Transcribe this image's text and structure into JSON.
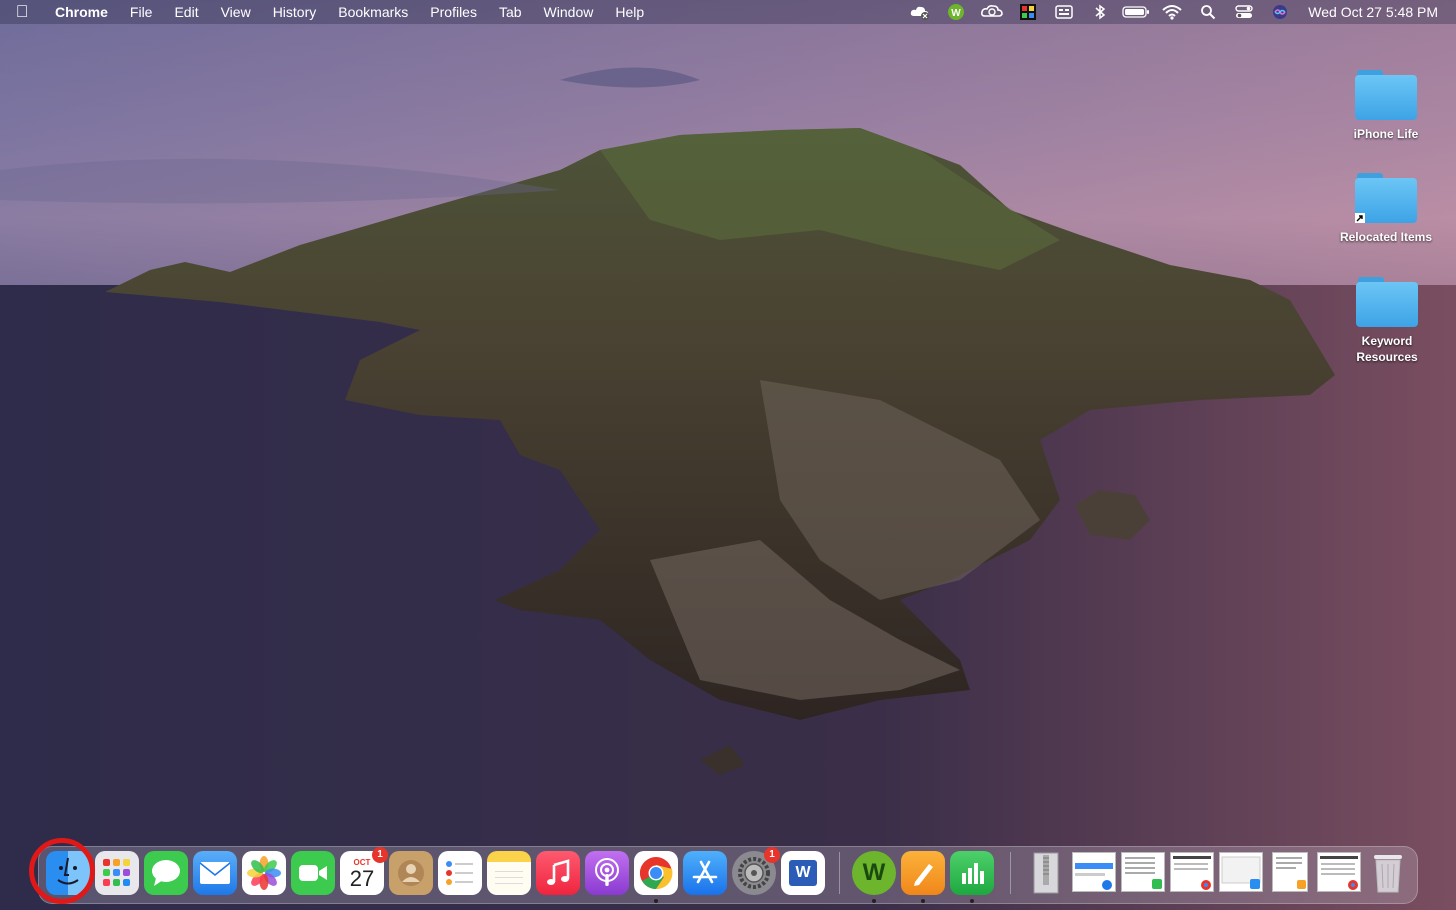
{
  "menubar": {
    "app_name": "Chrome",
    "items": [
      "File",
      "Edit",
      "View",
      "History",
      "Bookmarks",
      "Profiles",
      "Tab",
      "Window",
      "Help"
    ],
    "clock": "Wed Oct 27  5:48 PM",
    "status_icons": [
      "cloud-sync-icon",
      "grammarly-icon",
      "creative-cloud-icon",
      "color-app-icon",
      "display-icon",
      "bluetooth-icon",
      "battery-icon",
      "wifi-icon",
      "spotlight-icon",
      "control-center-icon",
      "siri-icon"
    ]
  },
  "desktop": {
    "items": [
      {
        "label": "iPhone Life"
      },
      {
        "label": "Relocated Items"
      },
      {
        "label": "Keyword Resources"
      }
    ]
  },
  "dock": {
    "apps": [
      {
        "name": "Finder",
        "icon": "finder-icon",
        "color": "#2a8ef0"
      },
      {
        "name": "Launchpad",
        "icon": "launchpad-icon",
        "color": "#e8e8ec"
      },
      {
        "name": "Messages",
        "icon": "messages-icon",
        "color": "#3ccb4f"
      },
      {
        "name": "Mail",
        "icon": "mail-icon",
        "color": "#3a8df6"
      },
      {
        "name": "Photos",
        "icon": "photos-icon",
        "color": "#ffffff"
      },
      {
        "name": "FaceTime",
        "icon": "facetime-icon",
        "color": "#3ccb4f"
      },
      {
        "name": "Calendar",
        "icon": "calendar-icon",
        "color": "#ffffff",
        "month": "OCT",
        "day": "27",
        "badge": "1"
      },
      {
        "name": "Contacts",
        "icon": "contacts-icon",
        "color": "#c8a06a"
      },
      {
        "name": "Reminders",
        "icon": "reminders-icon",
        "color": "#ffffff"
      },
      {
        "name": "Notes",
        "icon": "notes-icon",
        "color": "#fbe27a"
      },
      {
        "name": "Music",
        "icon": "music-icon",
        "color": "#fa3c54"
      },
      {
        "name": "Podcasts",
        "icon": "podcasts-icon",
        "color": "#9b4cd8"
      },
      {
        "name": "Chrome",
        "icon": "chrome-icon",
        "color": "#ffffff"
      },
      {
        "name": "App Store",
        "icon": "app-store-icon",
        "color": "#1f8cf5"
      },
      {
        "name": "System Preferences",
        "icon": "system-preferences-icon",
        "color": "#8a8a90",
        "badge": "1"
      },
      {
        "name": "Word",
        "icon": "word-icon",
        "color": "#2b5cb8"
      },
      {
        "name": "Grammarly",
        "icon": "grammarly-dock-icon",
        "color": "#6cb52d"
      },
      {
        "name": "Pages",
        "icon": "pages-icon",
        "color": "#f7a127"
      },
      {
        "name": "Numbers",
        "icon": "numbers-icon",
        "color": "#2fbe4f"
      }
    ],
    "calendar_month": "OCT",
    "calendar_day": "27",
    "calendar_badge": "1",
    "syspref_badge": "1",
    "word_letter": "W",
    "grammarly_letter": "W"
  }
}
